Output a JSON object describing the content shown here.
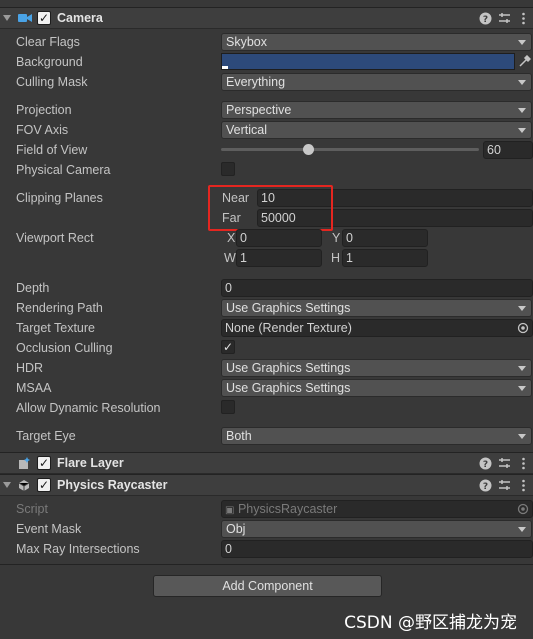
{
  "camera": {
    "title": "Camera",
    "clear_flags": {
      "label": "Clear Flags",
      "value": "Skybox"
    },
    "background": {
      "label": "Background",
      "color": "#2d4a7a"
    },
    "culling_mask": {
      "label": "Culling Mask",
      "value": "Everything"
    },
    "projection": {
      "label": "Projection",
      "value": "Perspective"
    },
    "fov_axis": {
      "label": "FOV Axis",
      "value": "Vertical"
    },
    "field_of_view": {
      "label": "Field of View",
      "value": "60",
      "slider_fraction": 0.29
    },
    "physical_camera": {
      "label": "Physical Camera",
      "checked": false
    },
    "clipping_planes": {
      "label": "Clipping Planes",
      "near_label": "Near",
      "near_value": "10",
      "far_label": "Far",
      "far_value": "50000"
    },
    "viewport_rect": {
      "label": "Viewport Rect",
      "x_label": "X",
      "x_value": "0",
      "y_label": "Y",
      "y_value": "0",
      "w_label": "W",
      "w_value": "1",
      "h_label": "H",
      "h_value": "1"
    },
    "depth": {
      "label": "Depth",
      "value": "0"
    },
    "rendering_path": {
      "label": "Rendering Path",
      "value": "Use Graphics Settings"
    },
    "target_texture": {
      "label": "Target Texture",
      "value": "None (Render Texture)"
    },
    "occlusion_culling": {
      "label": "Occlusion Culling",
      "checked": true
    },
    "hdr": {
      "label": "HDR",
      "value": "Use Graphics Settings"
    },
    "msaa": {
      "label": "MSAA",
      "value": "Use Graphics Settings"
    },
    "allow_dynamic_resolution": {
      "label": "Allow Dynamic Resolution",
      "checked": false
    },
    "target_eye": {
      "label": "Target Eye",
      "value": "Both"
    }
  },
  "flare_layer": {
    "title": "Flare Layer"
  },
  "physics_raycaster": {
    "title": "Physics Raycaster",
    "script": {
      "label": "Script",
      "value": "PhysicsRaycaster"
    },
    "event_mask": {
      "label": "Event Mask",
      "value": "Obj"
    },
    "max_ray": {
      "label": "Max Ray Intersections",
      "value": "0"
    }
  },
  "add_component_label": "Add Component",
  "watermark": "CSDN @野区捕龙为宠",
  "colors": {
    "highlight": "#e52620",
    "panel": "#383838",
    "header": "#3e3e3e"
  }
}
